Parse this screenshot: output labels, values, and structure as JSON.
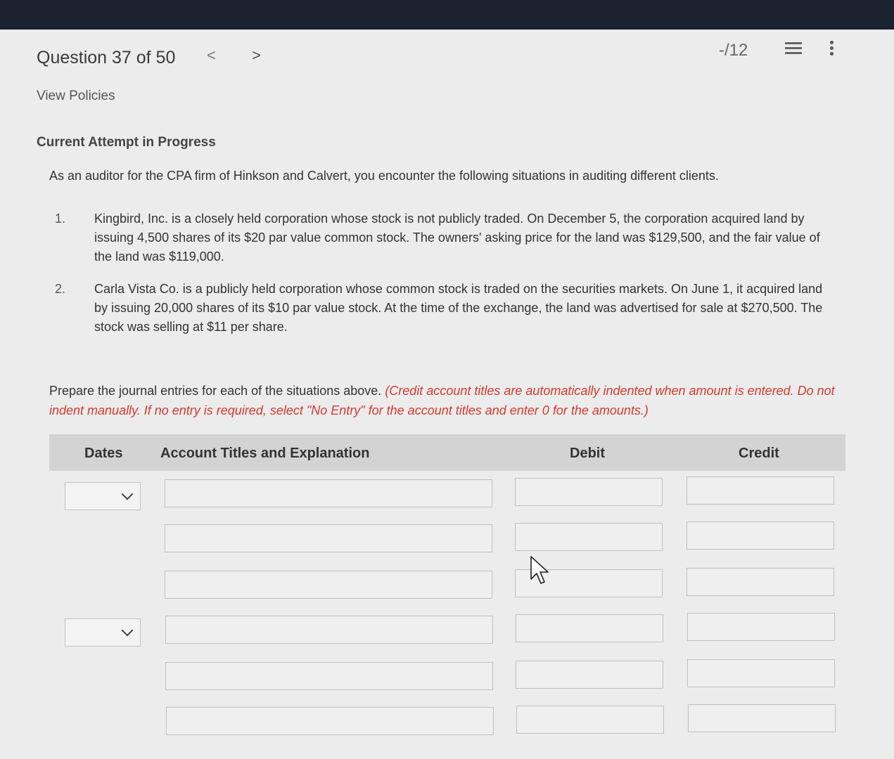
{
  "header": {
    "question_label": "Question 37 of 50",
    "prev_glyph": "<",
    "next_glyph": ">",
    "score": "-/12"
  },
  "links": {
    "view_policies": "View Policies"
  },
  "status": "Current Attempt in Progress",
  "intro": "As an auditor for the CPA firm of Hinkson and Calvert, you encounter the following situations in auditing different clients.",
  "situations": [
    {
      "num": "1.",
      "text": "Kingbird, Inc. is a closely held corporation whose stock is not publicly traded. On December 5, the corporation acquired land by issuing 4,500 shares of its $20 par value common stock. The owners' asking price for the land was $129,500, and the fair value of the land was $119,000."
    },
    {
      "num": "2.",
      "text": "Carla Vista Co. is a publicly held corporation whose common stock is traded on the securities markets. On June 1, it acquired land by issuing 20,000 shares of its $10 par value stock. At the time of the exchange, the land was advertised for sale at $270,500. The stock was selling at $11 per share."
    }
  ],
  "instructions": {
    "plain": "Prepare the journal entries for each of the situations above.",
    "red": "(Credit account titles are automatically indented when amount is entered. Do not indent manually. If no entry is required, select \"No Entry\" for the account titles and enter 0 for the amounts.)"
  },
  "table": {
    "headers": {
      "dates": "Dates",
      "account": "Account Titles and Explanation",
      "debit": "Debit",
      "credit": "Credit"
    }
  },
  "icons": {
    "list": "list-icon",
    "more": "more-vertical-icon",
    "chevron": "chevron-down-icon",
    "cursor": "mouse-pointer-icon"
  },
  "colors": {
    "topbar": "#1b2230",
    "instruction_red": "#d43a2f",
    "header_gray": "#d3d3d3"
  }
}
